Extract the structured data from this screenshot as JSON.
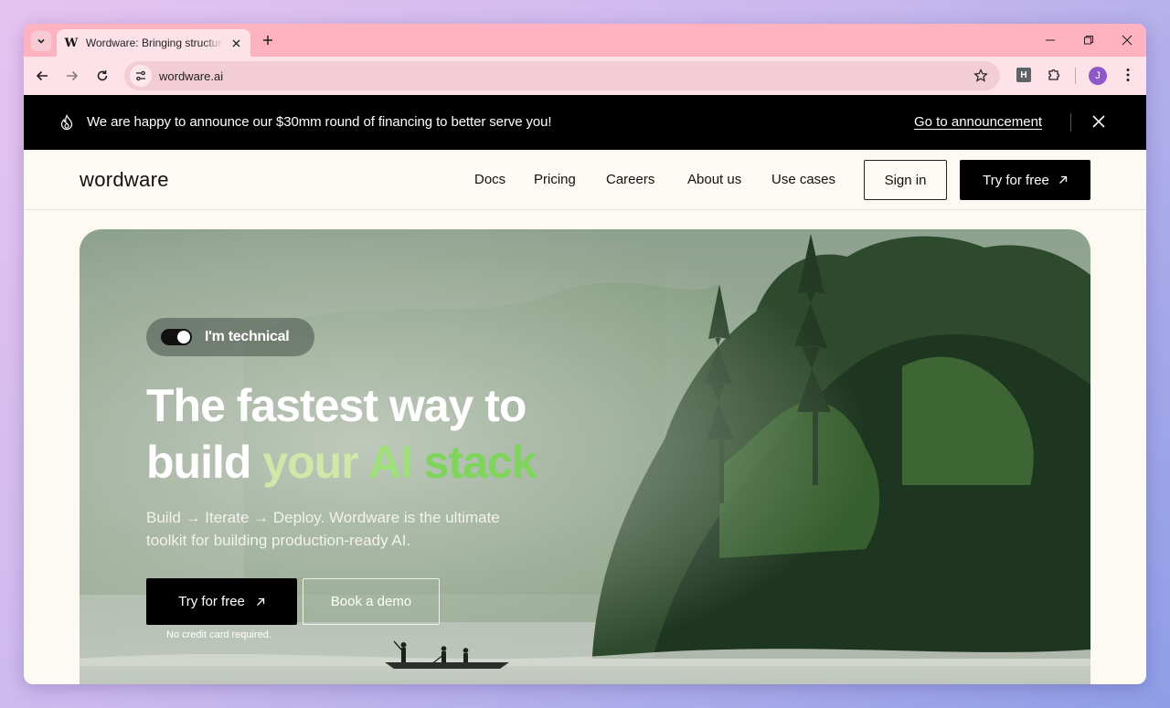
{
  "browser": {
    "tab": {
      "favicon": "W",
      "title": "Wordware: Bringing structure to"
    },
    "url": "wordware.ai",
    "extension_label": "H",
    "profile_initial": "J"
  },
  "announcement": {
    "text": "We are happy to announce our $30mm round of financing to better serve you!",
    "link": "Go to announcement"
  },
  "nav": {
    "logo": "wordware",
    "links": [
      "Docs",
      "Pricing",
      "Careers",
      "About us",
      "Use cases"
    ],
    "sign_in": "Sign in",
    "try_free": "Try for free"
  },
  "hero": {
    "toggle_label": "I'm technical",
    "toggle_on": true,
    "headline_line1": "The fastest way to",
    "headline_build": "build",
    "headline_your": "your",
    "headline_ai": "AI",
    "headline_stack": "stack",
    "subtext": "Build → Iterate → Deploy. Wordware is the ultimate toolkit for building production-ready AI.",
    "cta_primary": "Try for free",
    "cta_secondary": "Book a demo",
    "note": "No credit card required."
  },
  "colors": {
    "tabstrip": "#ffb3c1",
    "toolbar": "#fde3e9",
    "announcement_bg": "#000000",
    "page_bg": "#fdfaf3",
    "accent_green": "#7fd45c"
  }
}
